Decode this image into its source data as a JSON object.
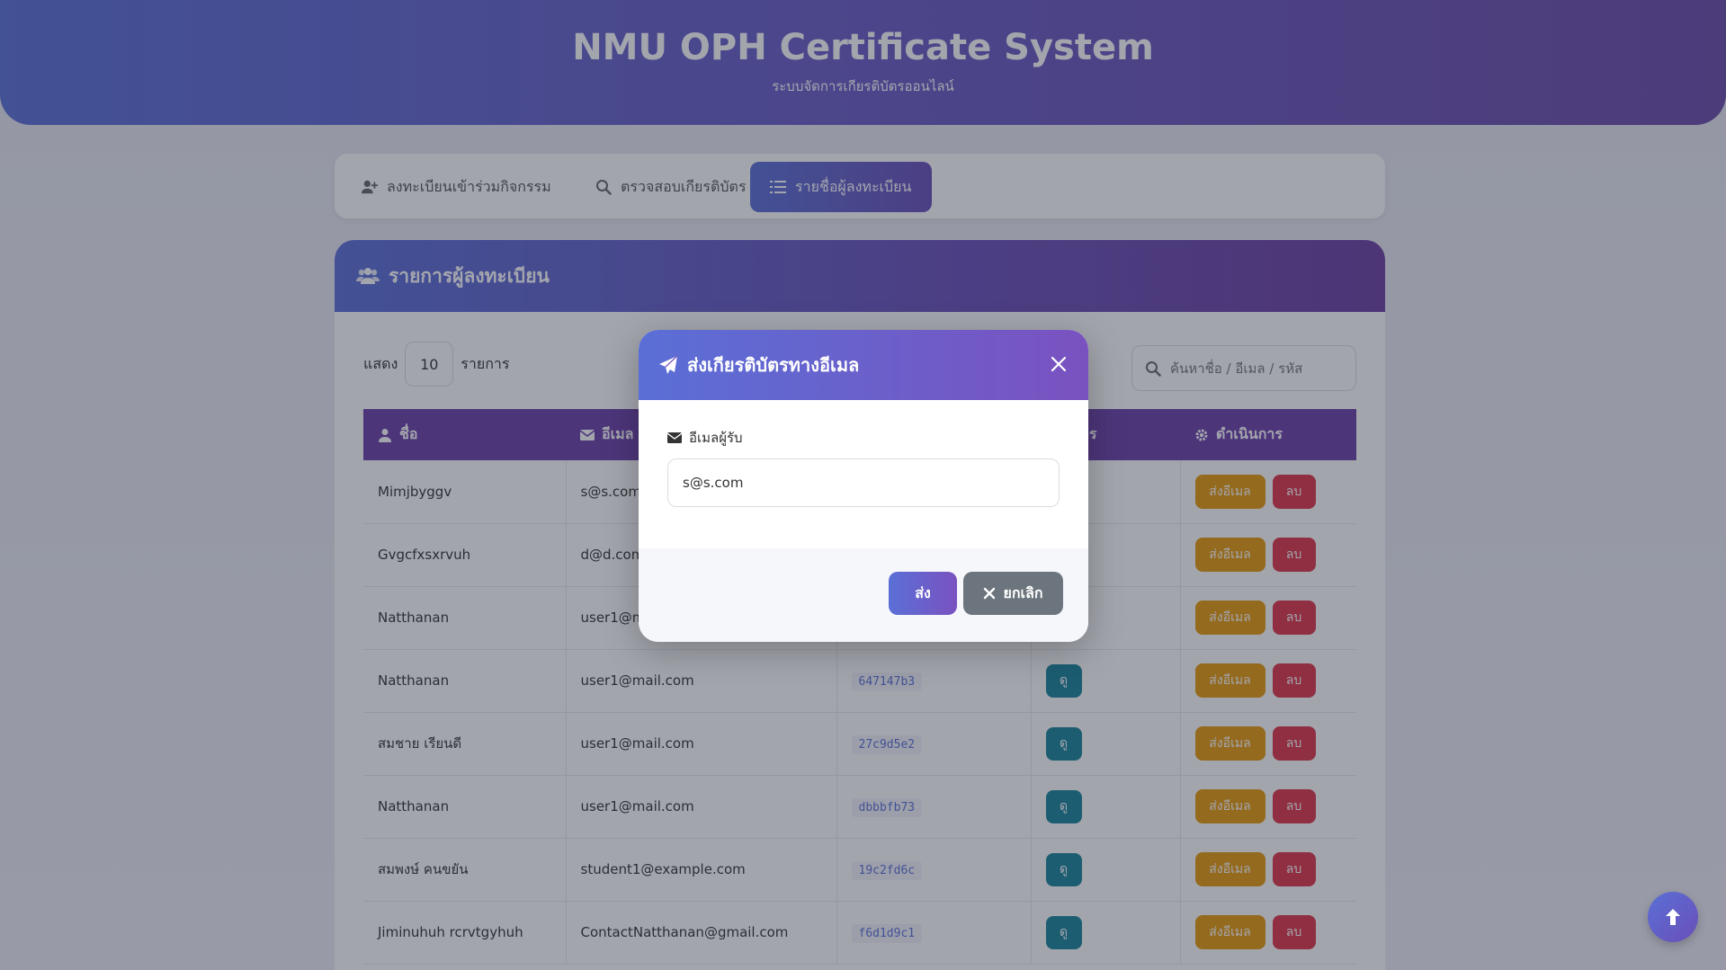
{
  "header": {
    "title": "NMU OPH Certificate System",
    "subtitle": "ระบบจัดการเกียรติบัตรออนไลน์"
  },
  "tabs": [
    {
      "label": "ลงทะเบียนเข้าร่วมกิจกรรม",
      "icon": "user-plus-icon"
    },
    {
      "label": "ตรวจสอบเกียรติบัตร",
      "icon": "search-icon"
    },
    {
      "label": "รายชื่อผู้ลงทะเบียน",
      "icon": "list-icon",
      "active": true
    }
  ],
  "list_card": {
    "title": "รายการผู้ลงทะเบียน",
    "show_label": "แสดง",
    "show_value": "10",
    "show_suffix": "รายการ",
    "search_placeholder": "ค้นหาชื่อ / อีเมล / รหัส",
    "columns": [
      "ชื่อ",
      "อีเมล",
      "",
      "ยรติบัตร",
      "ดำเนินการ"
    ],
    "send_email_label": "ส่งอีเมล",
    "delete_label": "ลบ",
    "view_label": "ดู",
    "rows": [
      {
        "name": "Mimjbyggv",
        "email": "s@s.com",
        "code": ""
      },
      {
        "name": "Gvgcfxsxrvuh",
        "email": "d@d.com",
        "code": ""
      },
      {
        "name": "Natthanan",
        "email": "user1@m",
        "code": ""
      },
      {
        "name": "Natthanan",
        "email": "user1@mail.com",
        "code": "647147b3"
      },
      {
        "name": "สมชาย เรียนดี",
        "email": "user1@mail.com",
        "code": "27c9d5e2"
      },
      {
        "name": "Natthanan",
        "email": "user1@mail.com",
        "code": "dbbbfb73"
      },
      {
        "name": "สมพงษ์ คนขยัน",
        "email": "student1@example.com",
        "code": "19c2fd6c"
      },
      {
        "name": "Jiminuhuh rcrvtgyhuh",
        "email": "ContactNatthanan@gmail.com",
        "code": "f6d1d9c1"
      }
    ]
  },
  "modal": {
    "title": "ส่งเกียรติบัตรทางอีเมล",
    "field_label": "อีเมลผู้รับ",
    "field_value": "s@s.com",
    "send_label": "ส่ง",
    "cancel_label": "ยกเลิก"
  },
  "colors": {
    "primary": "#5a6fd6",
    "purple": "#6b3fa8",
    "warning": "#e69a0a",
    "danger": "#dc3545",
    "info": "#17849a"
  }
}
